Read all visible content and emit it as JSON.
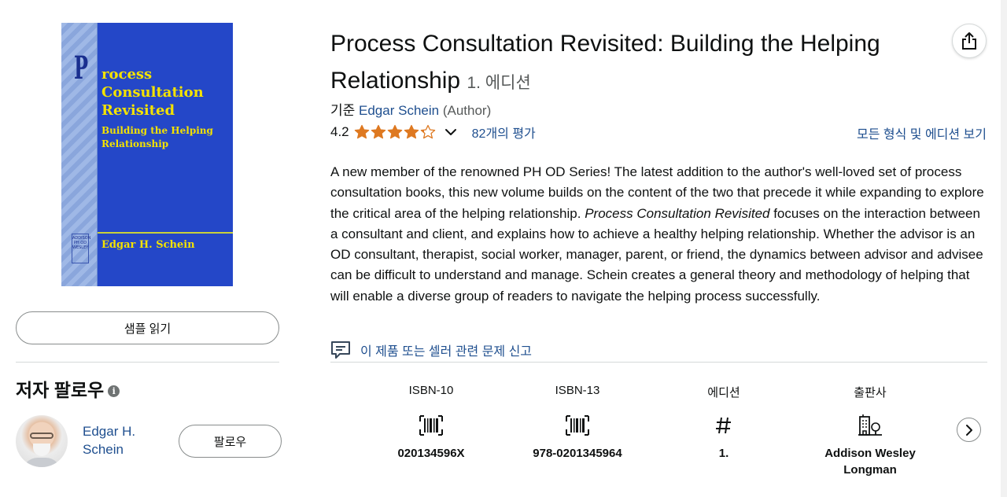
{
  "cover": {
    "letter": "P",
    "title_lines": [
      "rocess",
      "Consultation",
      "Revisited"
    ],
    "subtitle": "Building the Helping Relationship",
    "author": "Edgar H. Schein",
    "seal_text": "ADDISON PH OD WESLEY"
  },
  "sample_button": "샘플 읽기",
  "follow_section": {
    "heading": "저자 팔로우",
    "info_icon": "i",
    "author_name": "Edgar H. Schein",
    "follow_button": "팔로우"
  },
  "product": {
    "title": "Process Consultation Revisited: Building the Helping Relationship",
    "edition_suffix": "1. 에디션",
    "byline_prefix": "기준",
    "author": "Edgar Schein",
    "author_role": "(Author)",
    "rating_value": "4.2",
    "rating_stars": 4.2,
    "ratings_count": "82개의 평가",
    "all_formats_link": "모든 형식 및 에디션 보기"
  },
  "description": {
    "part1": "A new member of the renowned PH OD Series! The latest addition to the author's well-loved set of process consultation books, this new volume builds on the content of the two that precede it while expanding to explore the critical area of the helping relationship. ",
    "italic": "Process Consultation Revisited",
    "part2": " focuses on the interaction between a consultant and client, and explains how to achieve a healthy helping relationship. Whether the advisor is an OD consultant, therapist, social worker, manager, parent, or friend, the dynamics between advisor and advisee can be difficult to understand and manage. Schein creates a general theory and methodology of helping that will enable a diverse group of readers to navigate the helping process successfully."
  },
  "report_link": "이 제품 또는 셀러 관련 문제 신고",
  "details": [
    {
      "label": "ISBN-10",
      "icon": "barcode-icon",
      "value": "020134596X"
    },
    {
      "label": "ISBN-13",
      "icon": "barcode-icon",
      "value": "978-0201345964"
    },
    {
      "label": "에디션",
      "icon": "hash-icon",
      "value": "1."
    },
    {
      "label": "출판사",
      "icon": "building-icon",
      "value": "Addison Wesley Longman"
    }
  ],
  "colors": {
    "link": "#1f4f8f",
    "star": "#de7921",
    "cover_blue": "#2447c8",
    "cover_text": "#f3e200"
  }
}
